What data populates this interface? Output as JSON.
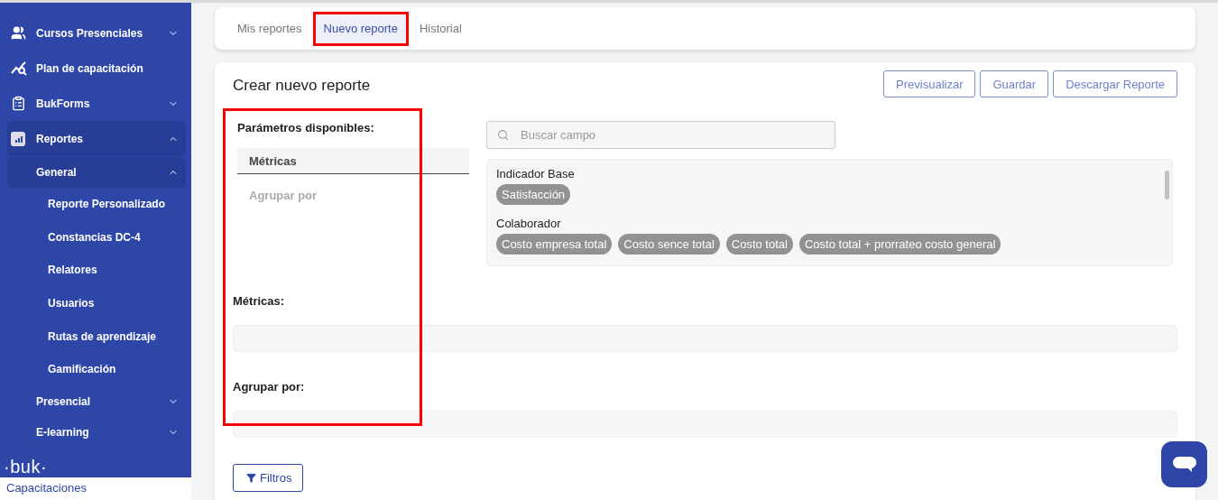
{
  "sidebar": {
    "items": [
      {
        "label": "Cursos Presenciales",
        "expanded": false
      },
      {
        "label": "Plan de capacitación"
      },
      {
        "label": "BukForms",
        "expanded": false
      },
      {
        "label": "Reportes",
        "expanded": true,
        "children": [
          {
            "label": "General",
            "expanded": true,
            "children": [
              {
                "label": "Reporte Personalizado"
              },
              {
                "label": "Constancias DC-4"
              },
              {
                "label": "Relatores"
              },
              {
                "label": "Usuarios"
              },
              {
                "label": "Rutas de aprendizaje"
              },
              {
                "label": "Gamificación"
              }
            ]
          },
          {
            "label": "Presencial",
            "expanded": false
          },
          {
            "label": "E-learning",
            "expanded": false
          }
        ]
      }
    ],
    "logo": "·buk·",
    "module": "Capacitaciones"
  },
  "tabs": [
    {
      "label": "Mis reportes",
      "selected": false,
      "highlighted": false
    },
    {
      "label": "Nuevo reporte",
      "selected": true,
      "highlighted": true
    },
    {
      "label": "Historial",
      "selected": false,
      "highlighted": false
    }
  ],
  "report": {
    "title": "Crear nuevo reporte",
    "highlighted": true,
    "buttons": [
      "Previsualizar",
      "Guardar",
      "Descargar Reporte"
    ],
    "parameters": {
      "heading": "Parámetros disponibles:",
      "tabs": [
        {
          "label": "Métricas",
          "selected": true
        },
        {
          "label": "Agrupar por",
          "selected": false
        }
      ]
    },
    "search": {
      "placeholder": "Buscar campo"
    },
    "groups": [
      {
        "name": "Indicador Base",
        "fields": [
          "Satisfacción"
        ]
      },
      {
        "name": "Colaborador",
        "fields": [
          "Costo empresa total",
          "Costo sence total",
          "Costo total",
          "Costo total + prorrateo costo general"
        ]
      }
    ],
    "sections": [
      "Métricas:",
      "Agrupar por:"
    ],
    "filters_button": "Filtros"
  }
}
